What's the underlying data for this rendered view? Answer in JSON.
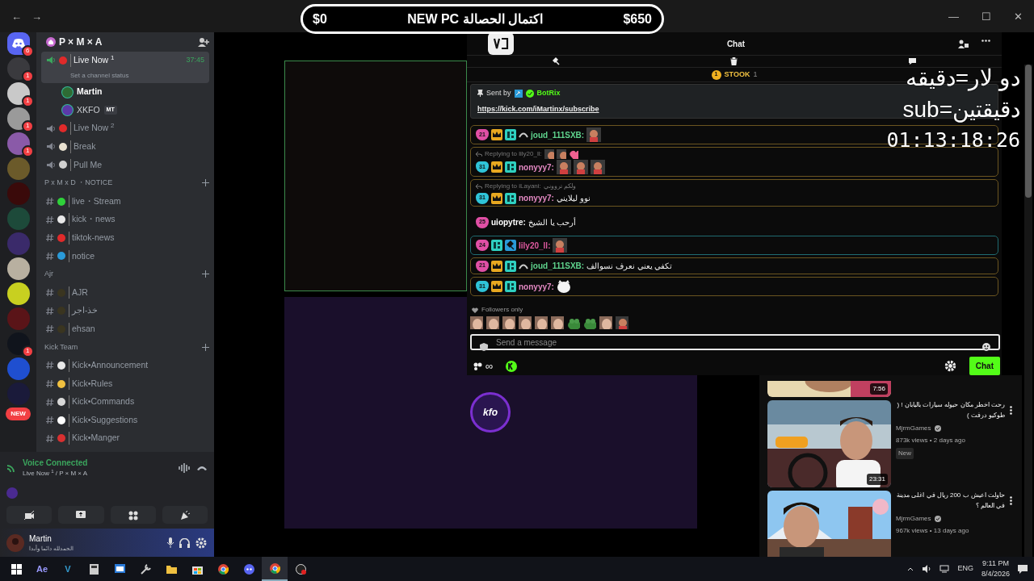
{
  "titlebar": {
    "nav": [
      "←",
      "→"
    ],
    "controls": [
      "—",
      "☐",
      "✕"
    ]
  },
  "goal": {
    "start": "$0",
    "title": "اكتمال الحصالة NEW PC",
    "end": "$650"
  },
  "discord": {
    "servers": [
      {
        "kind": "discord",
        "badge": "6"
      },
      {
        "kind": "avatar",
        "color": "#3a3a3e",
        "badge": "1"
      },
      {
        "kind": "avatar",
        "color": "#c9c9c9",
        "badge": "1"
      },
      {
        "kind": "avatar",
        "color": "#9a9a9a",
        "badge": "1"
      },
      {
        "kind": "avatar",
        "color": "#8a5aa8",
        "badge": "1"
      },
      {
        "kind": "avatar",
        "color": "#6b5a2a"
      },
      {
        "kind": "avatar",
        "color": "#3a0a0a"
      },
      {
        "kind": "avatar",
        "color": "#1d4a3a"
      },
      {
        "kind": "avatar",
        "color": "#3a2a6a"
      },
      {
        "kind": "avatar",
        "color": "#b8b0a0"
      },
      {
        "kind": "avatar",
        "color": "#c8d020"
      },
      {
        "kind": "avatar",
        "color": "#5a1418"
      },
      {
        "kind": "avatar",
        "color": "#10141c",
        "badge": "1"
      },
      {
        "kind": "avatar",
        "color": "#1f4fd0"
      },
      {
        "kind": "avatar",
        "color": "#1a1a3a"
      }
    ],
    "new_badge": "NEW",
    "server_name": "P × M × A",
    "channels": [
      {
        "kind": "voice",
        "name": "Live Now $^{1}$",
        "color": "#e02a2a",
        "selected": true,
        "timer": "37:45",
        "status": "Set a channel status"
      },
      {
        "kind": "member",
        "name": "Martin",
        "color": "#2e6b34",
        "selected": false
      },
      {
        "kind": "member",
        "name": "XKFO",
        "tag": "MT",
        "color": "#5b3aa8",
        "selected": false
      },
      {
        "kind": "voice",
        "name": "Live Now $^{2}$",
        "color": "#e02a2a",
        "selected": false
      },
      {
        "kind": "voice",
        "name": "Break",
        "color": "#e8e0d0",
        "selected": false
      },
      {
        "kind": "voice",
        "name": "Pull Me",
        "color": "#cfcfcf",
        "selected": false
      },
      {
        "kind": "category",
        "name": "P x M x D ・NOTICE",
        "selected": false
      },
      {
        "kind": "text",
        "name": "live・Stream",
        "color": "#2fd13a",
        "selected": false
      },
      {
        "kind": "text",
        "name": "kick・news",
        "color": "#e8e8e8",
        "selected": false
      },
      {
        "kind": "text",
        "name": "tiktok-news",
        "color": "#e02a2a",
        "selected": false
      },
      {
        "kind": "text",
        "name": "notice",
        "color": "#2a9ad8",
        "selected": false
      },
      {
        "kind": "category",
        "name": "Ajr",
        "selected": false
      },
      {
        "kind": "text",
        "name": "AJR",
        "color": "#3a3520",
        "selected": false
      },
      {
        "kind": "text",
        "name": "خذ-اجر",
        "color": "#3a3520",
        "selected": false
      },
      {
        "kind": "text",
        "name": "ehsan",
        "color": "#3a3520",
        "selected": false
      },
      {
        "kind": "category",
        "name": "Kick Team",
        "selected": false
      },
      {
        "kind": "text",
        "name": "Kick•Announcement",
        "color": "#e8e8e8",
        "selected": false
      },
      {
        "kind": "text",
        "name": "Kick•Rules",
        "color": "#f0c040",
        "selected": false
      },
      {
        "kind": "text",
        "name": "Kick•Commands",
        "color": "#d8d8d8",
        "selected": false
      },
      {
        "kind": "text",
        "name": "Kick•Suggestions",
        "color": "#ffffff",
        "selected": false
      },
      {
        "kind": "text",
        "name": "Kick•Manger",
        "color": "#d83030",
        "selected": false
      }
    ],
    "voice": {
      "title": "Voice Connected",
      "channel": "Live Now $^{1}$ / P × M × A"
    },
    "user": {
      "name": "Martin",
      "status": "الحمدلله دائما وأبدا"
    }
  },
  "layout": {
    "avatar_text": "kfo"
  },
  "chat": {
    "title": "Chat",
    "pinned_label": "STOOK",
    "pinned_count": "1",
    "pinned_badge": "1",
    "pin": {
      "sent_by": "Sent by",
      "author": "BotRix",
      "link": "https://kick.com/iMartinx/subscribe"
    },
    "messages": [
      {
        "kind": "sub",
        "badge": {
          "text": "21",
          "color": "#e04fa5"
        },
        "icons": [
          {
            "kind": "crown"
          },
          {
            "kind": "sub"
          },
          {
            "kind": "arrow"
          }
        ],
        "user": {
          "name": "joud_111SXB:",
          "color": "#5fd38d"
        },
        "emotes": [
          {
            "kind": "sticker"
          }
        ]
      },
      {
        "kind": "sub",
        "reply": "Replying to lily20_ll:",
        "reply_emotes": [
          {
            "kind": "sticker"
          },
          {
            "kind": "sticker"
          },
          {
            "kind": "heart"
          }
        ],
        "badge": {
          "text": "31",
          "color": "#2fc4d8"
        },
        "icons": [
          {
            "kind": "crown"
          },
          {
            "kind": "sub"
          }
        ],
        "user": {
          "name": "nonyyy7:",
          "color": "#e58ac4"
        },
        "emotes": [
          {
            "kind": "sticker"
          },
          {
            "kind": "sticker"
          },
          {
            "kind": "sticker"
          }
        ]
      },
      {
        "kind": "sub",
        "reply": "Replying to iLayani:",
        "reply_text": "ولكم ترووني",
        "badge": {
          "text": "31",
          "color": "#2fc4d8"
        },
        "icons": [
          {
            "kind": "crown"
          },
          {
            "kind": "sub"
          }
        ],
        "user": {
          "name": "nonyyy7:",
          "color": "#e58ac4"
        },
        "text": "نوو ليلايني"
      },
      {
        "kind": "plain",
        "badge": {
          "text": "25",
          "color": "#e04fa5"
        },
        "user": {
          "name": "uiopytre:",
          "color": "#ffffff"
        },
        "text": "أرحب يا الشيخ"
      },
      {
        "kind": "mod",
        "badge": {
          "text": "24",
          "color": "#e04fa5"
        },
        "icons": [
          {
            "kind": "sub"
          },
          {
            "kind": "hammer"
          }
        ],
        "user": {
          "name": "lily20_ll:",
          "color": "#e05aa0"
        },
        "emotes": [
          {
            "kind": "sticker"
          }
        ]
      },
      {
        "kind": "sub",
        "badge": {
          "text": "21",
          "color": "#e04fa5"
        },
        "icons": [
          {
            "kind": "crown"
          },
          {
            "kind": "sub"
          },
          {
            "kind": "arrow"
          }
        ],
        "user": {
          "name": "joud_111SXB:",
          "color": "#5fd38d"
        },
        "text": "تكفي يعني نعرف نسوالف"
      },
      {
        "kind": "sub",
        "badge": {
          "text": "31",
          "color": "#2fc4d8"
        },
        "icons": [
          {
            "kind": "crown"
          },
          {
            "kind": "sub"
          }
        ],
        "user": {
          "name": "nonyyy7:",
          "color": "#e58ac4"
        },
        "emotes": [
          {
            "kind": "cat"
          }
        ]
      }
    ],
    "mode": "Followers only",
    "quick_emotes": [
      {
        "kind": "face"
      },
      {
        "kind": "face"
      },
      {
        "kind": "face"
      },
      {
        "kind": "face"
      },
      {
        "kind": "face"
      },
      {
        "kind": "face"
      },
      {
        "kind": "frog"
      },
      {
        "kind": "frog"
      },
      {
        "kind": "face"
      },
      {
        "kind": "sticker"
      }
    ],
    "input": {
      "placeholder": "Send a message"
    },
    "infinity": "∞",
    "send": "Chat"
  },
  "overlay_text": [
    "دو لار=دقيقه",
    "sub=دقيقتين",
    "01:13:18:26"
  ],
  "videos": [
    {
      "duration": "7:56"
    },
    {
      "title": "رحت اخطر مكان حيوله سيارات باليابان ! ( طوكيو درفت )",
      "channel": "MjrmGames",
      "meta": "873k views • 2 days ago",
      "badge": "New",
      "duration": "23:31"
    },
    {
      "title": "حاولت اعيش ب 200 ريال في اغلى مدينة في العالم ؟",
      "channel": "MjrmGames",
      "meta": "967k views • 13 days ago"
    }
  ],
  "taskbar": {
    "apps": [
      {
        "kind": "start",
        "selected": false
      },
      {
        "kind": "ae",
        "label": "Ae",
        "selected": false
      },
      {
        "kind": "v",
        "label": "V",
        "selected": false
      },
      {
        "kind": "calculator",
        "selected": false
      },
      {
        "kind": "window",
        "selected": false
      },
      {
        "kind": "tool",
        "selected": false
      },
      {
        "kind": "folder",
        "selected": false
      },
      {
        "kind": "store",
        "selected": false
      },
      {
        "kind": "chrome",
        "selected": false
      },
      {
        "kind": "discord",
        "selected": false
      },
      {
        "kind": "chrome",
        "selected": true
      },
      {
        "kind": "obs",
        "selected": false
      }
    ],
    "lang": "ENG",
    "time": "9:11 PM",
    "date": "8/4/2026"
  }
}
